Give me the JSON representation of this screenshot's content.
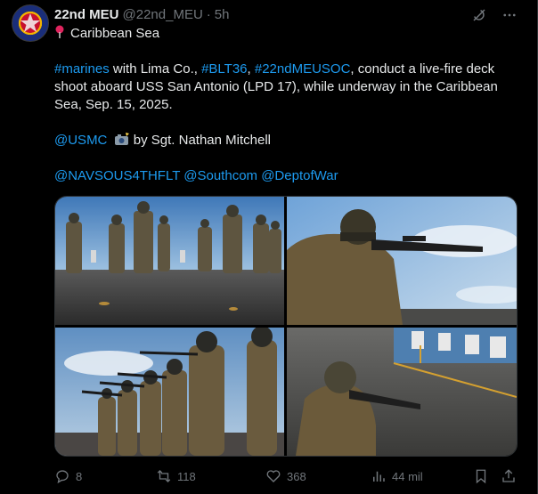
{
  "header": {
    "name": "22nd MEU",
    "handle": "@22nd_MEU",
    "separator": "·",
    "time": "5h"
  },
  "body": {
    "location": "Caribbean Sea",
    "paragraph1": {
      "tag1": "#marines",
      "text1": " with Lima Co., ",
      "tag2": "#BLT36",
      "text2": ", ",
      "tag3": "#22ndMEUSOC",
      "text3": ", conduct a live-fire deck shoot aboard USS San Antonio (LPD 17), while underway in the Caribbean Sea, Sep. 15, 2025."
    },
    "credit": {
      "mention": "@USMC",
      "text": " by Sgt. Nathan Mitchell"
    },
    "mentions": [
      "@NAVSOUS4THFLT",
      "@Southcom",
      "@DeptofWar"
    ]
  },
  "actions": {
    "replies": "8",
    "reposts": "118",
    "likes": "368",
    "views": "44 mil"
  },
  "colors": {
    "link": "#1d9bf0",
    "muted": "#71767b",
    "text": "#e7e9ea",
    "background": "#000000"
  },
  "icons": [
    "camera-flash-icon",
    "grok-icon",
    "more-icon",
    "reply-icon",
    "repost-icon",
    "like-icon",
    "views-icon",
    "bookmark-icon",
    "share-icon",
    "location-pin-icon"
  ]
}
